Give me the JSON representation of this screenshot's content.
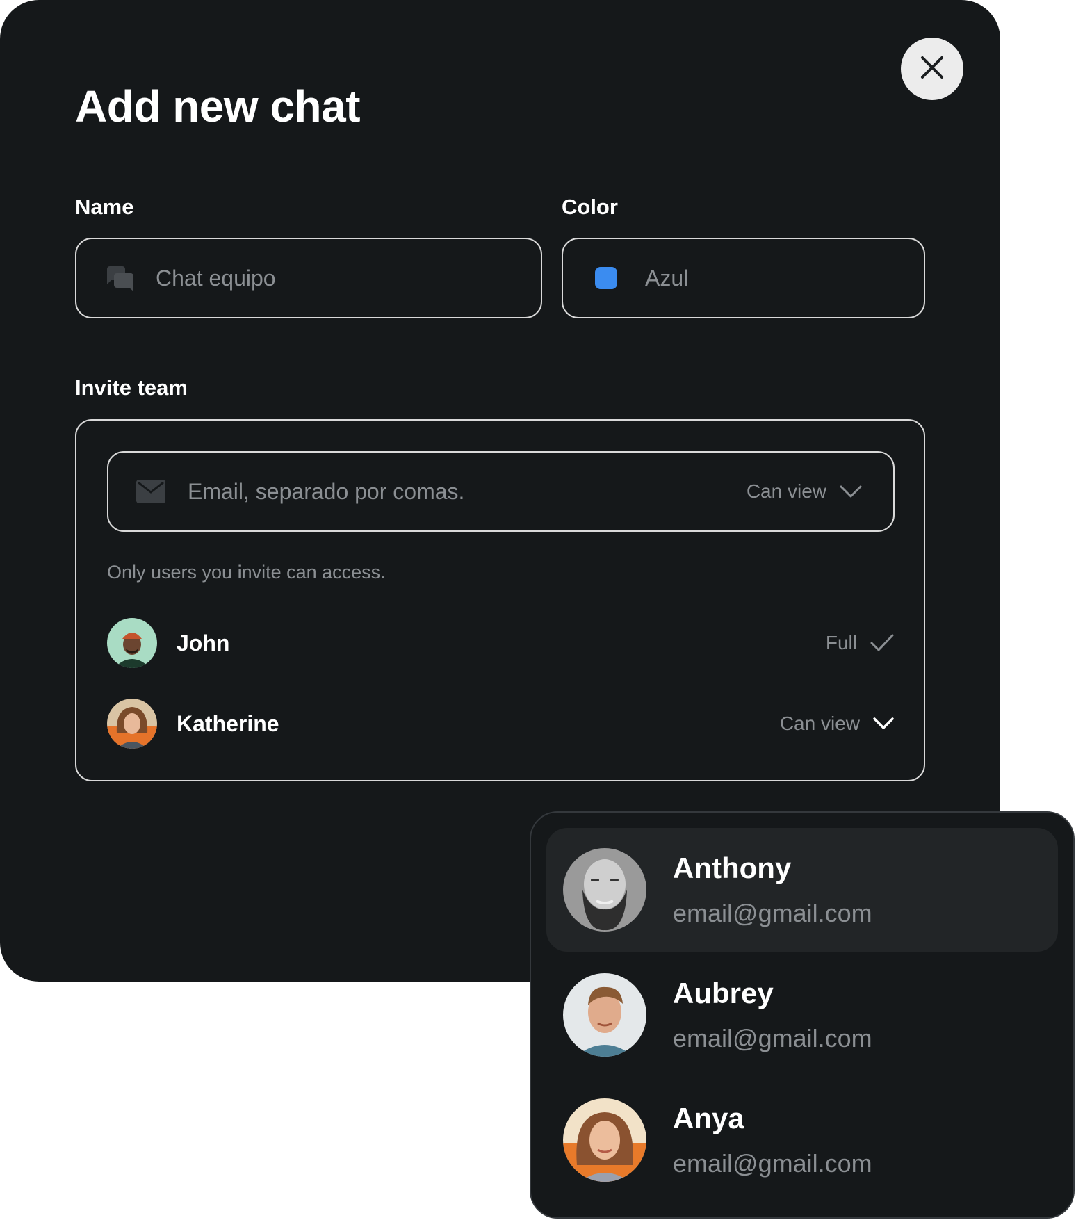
{
  "modal": {
    "title": "Add new chat",
    "name_label": "Name",
    "name_value": "Chat equipo",
    "color_label": "Color",
    "color_value": "Azul",
    "color_swatch": "#3b8cf0",
    "invite_label": "Invite team",
    "email_placeholder": "Email, separado por comas.",
    "email_permission": "Can view",
    "hint": "Only users you invite can access.",
    "members": [
      {
        "name": "John",
        "permission": "Full",
        "permission_icon": "check-icon"
      },
      {
        "name": "Katherine",
        "permission": "Can view",
        "permission_icon": "chevron-down-icon"
      }
    ]
  },
  "dropdown": {
    "options": [
      {
        "name": "Anthony",
        "email": "email@gmail.com",
        "active": true
      },
      {
        "name": "Aubrey",
        "email": "email@gmail.com",
        "active": false
      },
      {
        "name": "Anya",
        "email": "email@gmail.com",
        "active": false
      }
    ]
  },
  "colors": {
    "background": "#15181a",
    "border": "#d9d9d9",
    "muted_text": "#8b8f93",
    "active_option": "#222527"
  }
}
